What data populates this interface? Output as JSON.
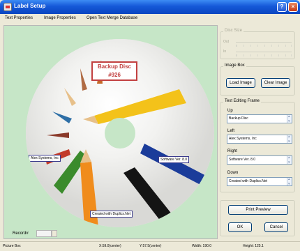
{
  "window": {
    "title": "Label Setup",
    "help_glyph": "?",
    "close_glyph": "×"
  },
  "menu": [
    "Text Properties",
    "Image Properties",
    "Open Text Merge Database"
  ],
  "disc": {
    "up_line1": "Backup Disc",
    "up_line2": "#926",
    "left": "Alex Systems, Inc",
    "right": "Software Ver. 8.0",
    "down": "Created with Duplics.Net",
    "colors": {
      "yellow": "#f3c21a",
      "orange": "#f08c1c",
      "green": "#3b8b2c",
      "blue": "#1b3c9a",
      "black": "#141414",
      "red": "#c23a2a",
      "wood": "#e7c08a"
    }
  },
  "record": {
    "label": "Record#",
    "value": ""
  },
  "disc_size": {
    "title": "Disc Size",
    "outer_label": "Out",
    "inner_label": "In"
  },
  "image_box": {
    "title": "Image Box",
    "load": "Load Image",
    "clear": "Clear Image"
  },
  "text_frame": {
    "title": "Text Editing Frame",
    "up": {
      "label": "Up",
      "value": "Backup Disc"
    },
    "left": {
      "label": "Left",
      "value": "Alex Systems, Inc"
    },
    "right": {
      "label": "Right",
      "value": "Software Ver. 8.0"
    },
    "down": {
      "label": "Down",
      "value": "Created with Duplics.Net"
    }
  },
  "actions": {
    "print_preview": "Print Preview",
    "ok": "OK",
    "cancel": "Cancel"
  },
  "status": {
    "box": "Picture Box",
    "x": "X:59.0(center)",
    "y": "Y:57.5(center)",
    "width": "Width: 190.0",
    "height": "Height: 125.1"
  }
}
